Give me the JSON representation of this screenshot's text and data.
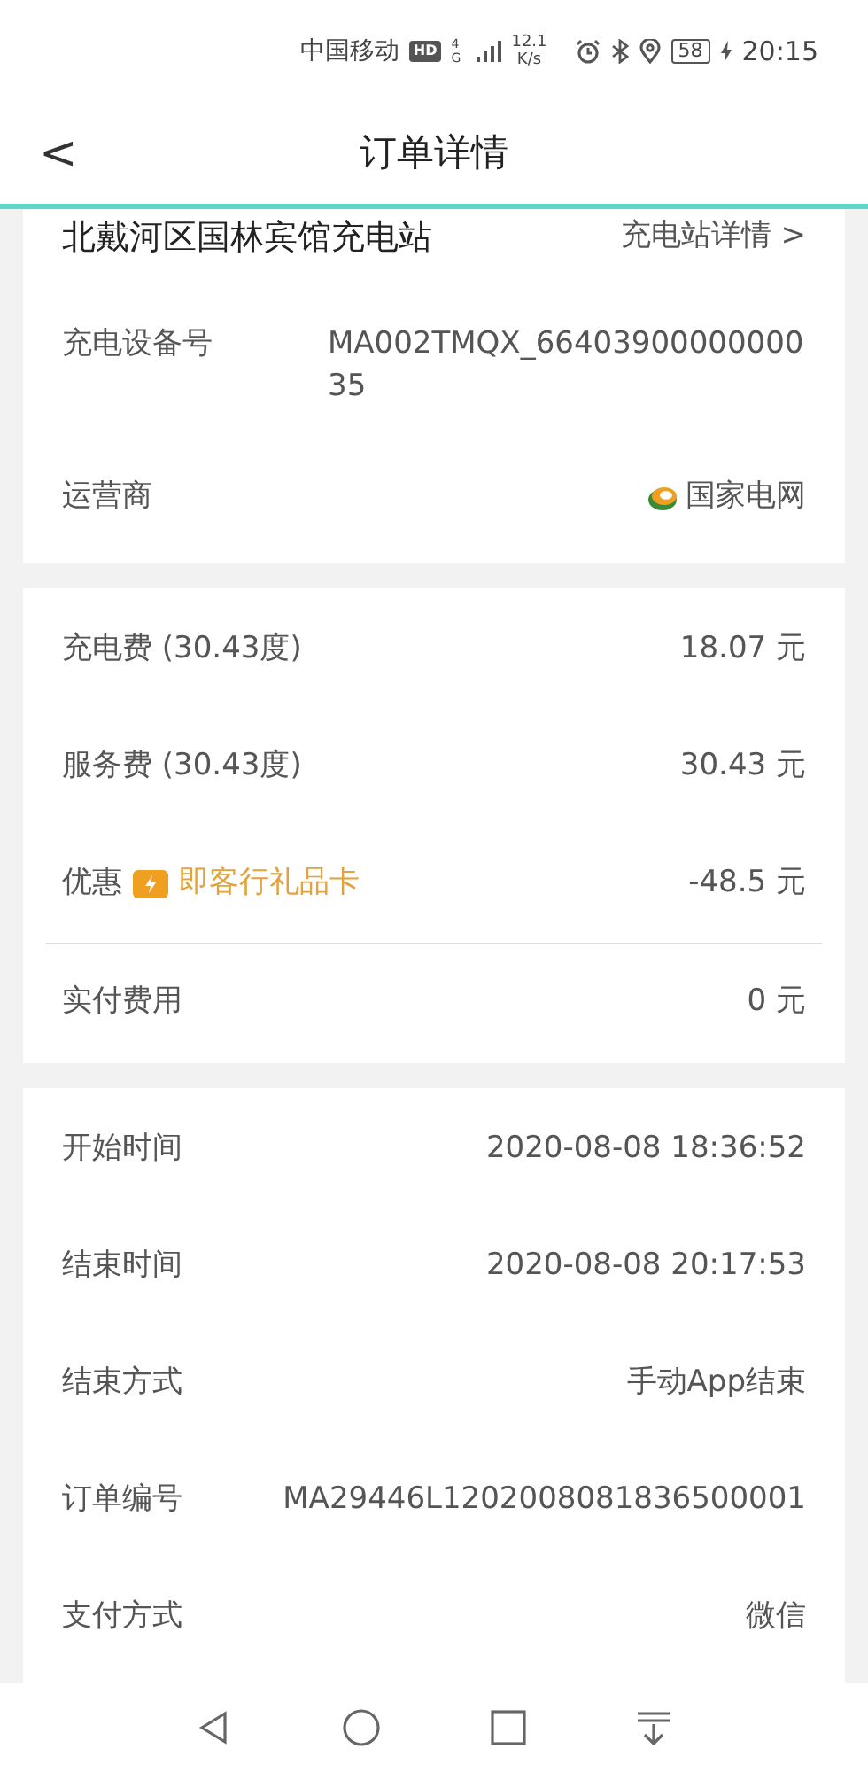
{
  "status_bar": {
    "carrier": "中国移动",
    "hd": "HD",
    "network": "4G",
    "speed": "12.1",
    "speed_unit": "K/s",
    "battery": "58",
    "time": "20:15"
  },
  "header": {
    "back": "<",
    "title": "订单详情"
  },
  "station": {
    "name": "北戴河区国林宾馆充电站",
    "link": "充电站详情 >",
    "device_label": "充电设备号",
    "device_value": "MA002TMQX_6640390000000035",
    "operator_label": "运营商",
    "operator_value": "国家电网"
  },
  "fees": [
    {
      "kind": "plain",
      "label": "充电费 (30.43度)",
      "value": "18.07 元"
    },
    {
      "kind": "plain",
      "label": "服务费 (30.43度)",
      "value": "30.43 元"
    },
    {
      "kind": "discount",
      "label": "优惠",
      "tag": "即客行礼品卡",
      "value": "-48.5 元"
    },
    {
      "kind": "total",
      "label": "实付费用",
      "value": "0 元"
    }
  ],
  "details": [
    {
      "label": "开始时间",
      "value": "2020-08-08 18:36:52"
    },
    {
      "label": "结束时间",
      "value": "2020-08-08 20:17:53"
    },
    {
      "label": "结束方式",
      "value": "手动App结束"
    },
    {
      "label": "订单编号",
      "value": "MA29446L1202008081836500001"
    },
    {
      "label": "支付方式",
      "value": "微信"
    }
  ]
}
